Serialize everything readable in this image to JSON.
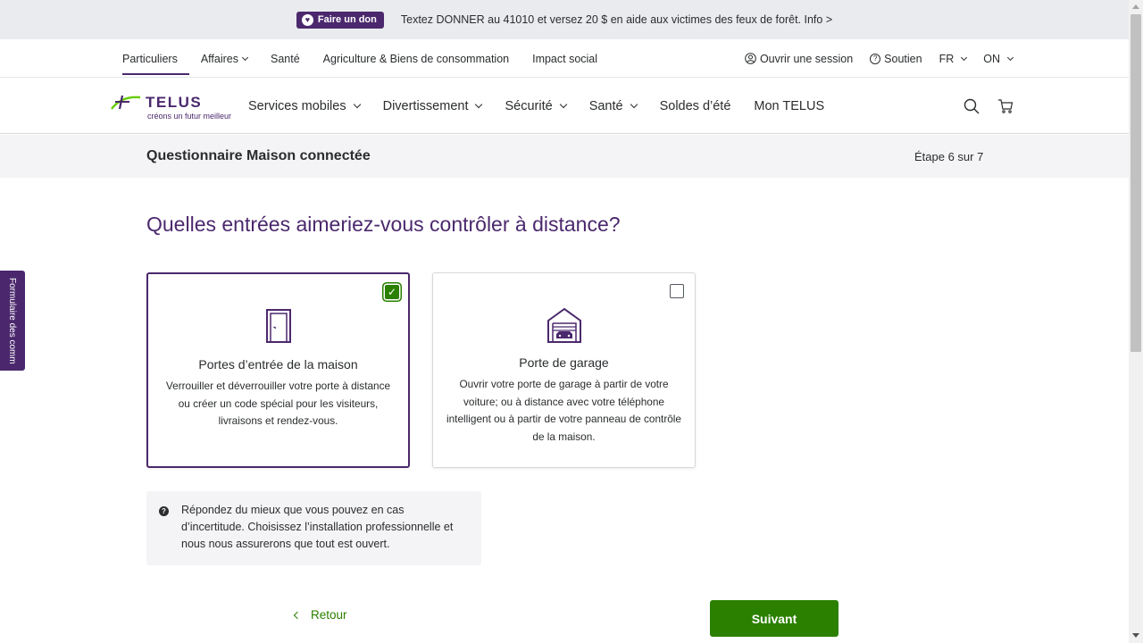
{
  "promo": {
    "badge_label": "Faire un don",
    "text": "Textez DONNER au 41010 et versez 20 $ en aide aux victimes des feux de forêt. Info >"
  },
  "utility_nav": {
    "items": [
      {
        "label": "Particuliers",
        "active": true
      },
      {
        "label": "Affaires",
        "dropdown": true
      },
      {
        "label": "Santé"
      },
      {
        "label": "Agriculture & Biens de consommation"
      },
      {
        "label": "Impact social"
      }
    ],
    "signin_label": "Ouvrir une session",
    "support_label": "Soutien",
    "language": "FR",
    "region": "ON"
  },
  "main_nav": {
    "logo_word": "TELUS",
    "logo_tagline": "créons un futur meilleur",
    "items": [
      {
        "label": "Services mobiles"
      },
      {
        "label": "Divertissement"
      },
      {
        "label": "Sécurité"
      },
      {
        "label": "Santé"
      },
      {
        "label": "Soldes d’été"
      },
      {
        "label": "Mon TELUS"
      }
    ]
  },
  "quiz": {
    "title": "Questionnaire Maison connectée",
    "step": "Étape 6 sur 7",
    "question": "Quelles entrées aimeriez-vous contrôler à distance?",
    "options": [
      {
        "icon": "door-icon",
        "title": "Portes d’entrée de la maison",
        "description": "Verrouiller et déverrouiller votre porte à distance ou créer un code spécial pour les visiteurs, livraisons et rendez-vous.",
        "checked": true
      },
      {
        "icon": "garage-icon",
        "title": "Porte de garage",
        "description": "Ouvrir votre porte de garage à partir de votre voiture; ou à distance avec votre téléphone intelligent ou à partir de votre panneau de contrôle de la maison.",
        "checked": false
      }
    ],
    "hint": "Répondez du mieux que vous pouvez en cas d’incertitude. Choisissez l’installation professionnelle et nous nous assurerons que tout est ouvert.",
    "back_label": "Retour",
    "next_label": "Suivant"
  },
  "feedback_tab_label": "Formulaire des commentaires",
  "colors": {
    "brand_purple": "#4b286d",
    "brand_green": "#2b8000",
    "panel_grey": "#f4f4f7"
  }
}
